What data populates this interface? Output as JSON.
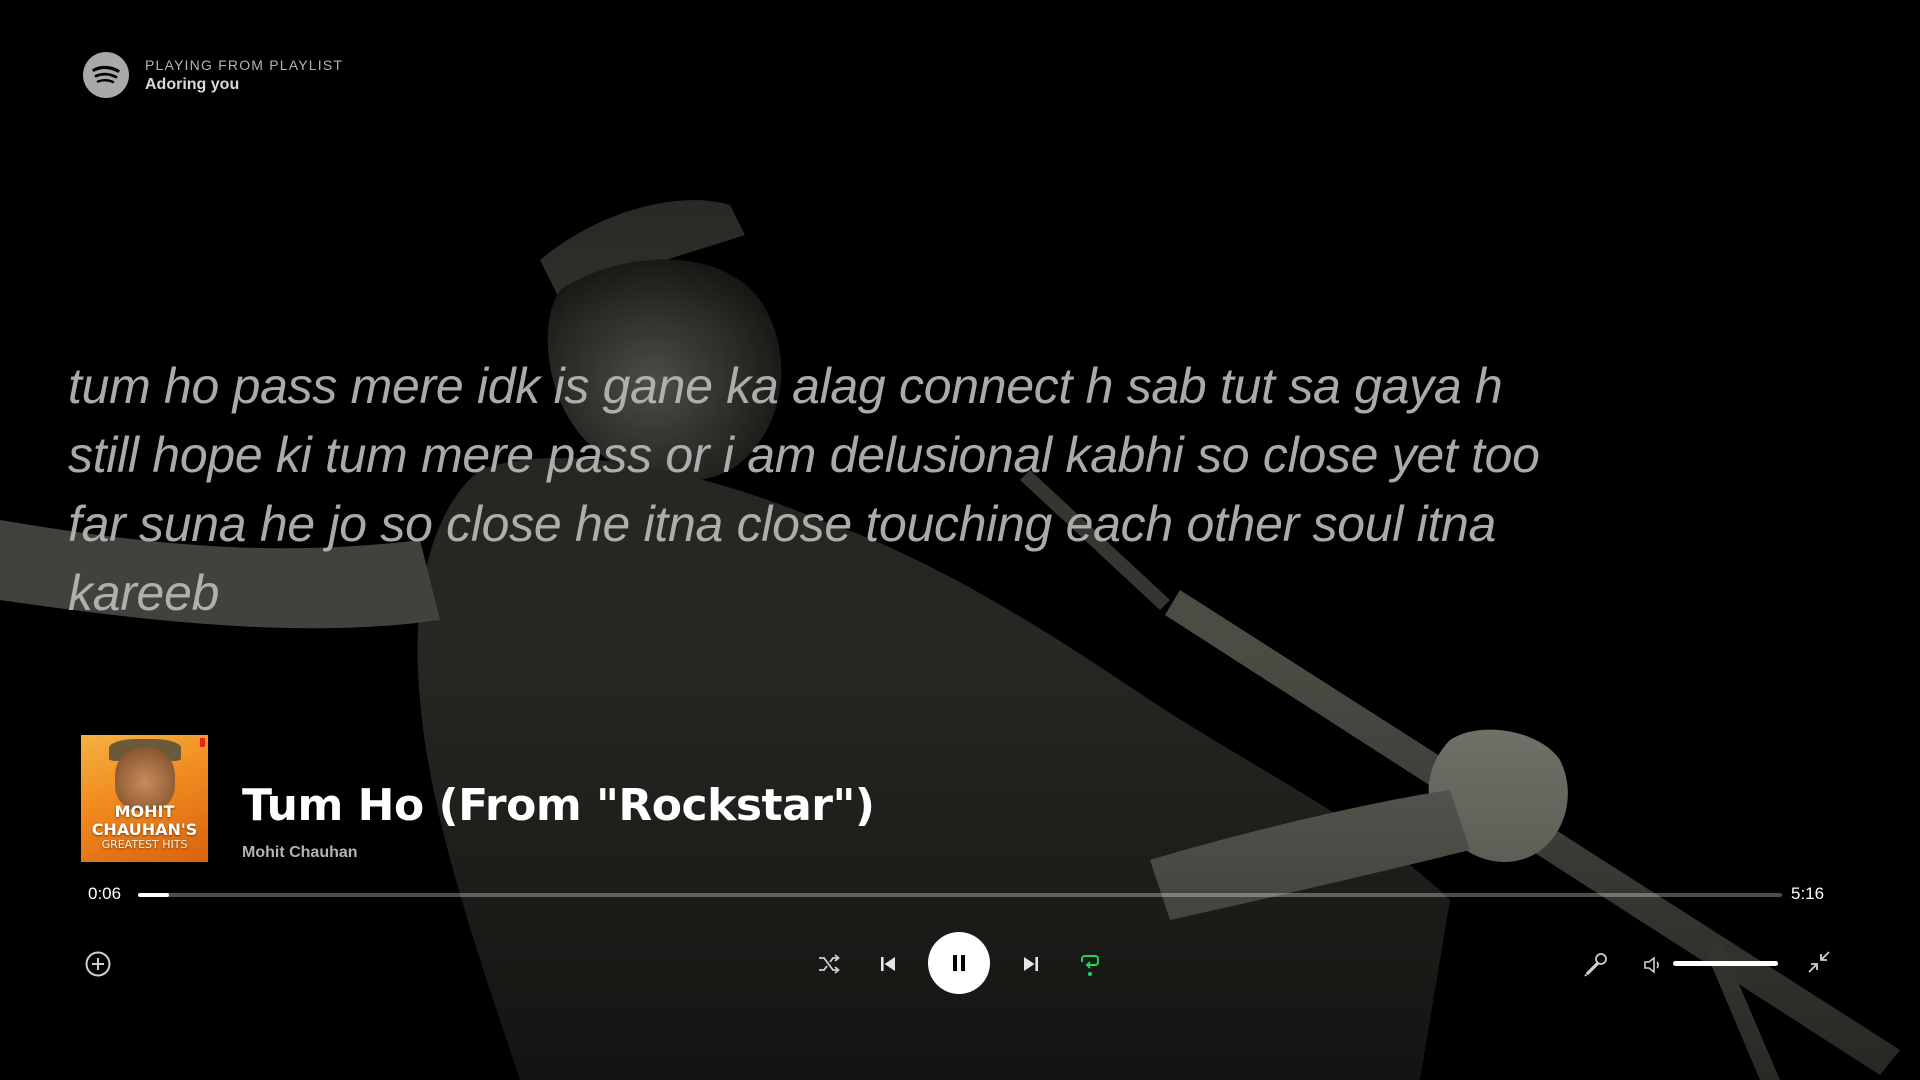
{
  "header": {
    "context_label": "PLAYING FROM PLAYLIST",
    "playlist_name": "Adoring you"
  },
  "lyrics": {
    "text": "tum ho pass mere idk is gane ka alag connect h sab tut sa gaya h still hope ki tum mere pass or i am delusional kabhi so close yet too far suna he jo so close he itna close touching each other soul itna kareeb"
  },
  "now_playing": {
    "title": "Tum Ho (From \"Rockstar\")",
    "artist": "Mohit Chauhan",
    "album_art_text": {
      "line1": "MOHIT",
      "line2": "CHAUHAN'S",
      "line3": "GREATEST HITS"
    }
  },
  "playback": {
    "elapsed": "0:06",
    "total": "5:16",
    "progress_fraction": 0.019,
    "volume_fraction": 1.0,
    "state": "playing",
    "repeat_active": true
  },
  "icons": {
    "logo": "spotify-logo-icon",
    "add": "add-circle-icon",
    "shuffle": "shuffle-icon",
    "previous": "skip-previous-icon",
    "pause": "pause-icon",
    "next": "skip-next-icon",
    "repeat": "repeat-icon",
    "lyrics": "microphone-icon",
    "volume": "volume-icon",
    "fullscreen": "exit-fullscreen-icon"
  },
  "colors": {
    "accent": "#1ed760",
    "background": "#000000",
    "lyrics_text": "#b9b9b9"
  }
}
